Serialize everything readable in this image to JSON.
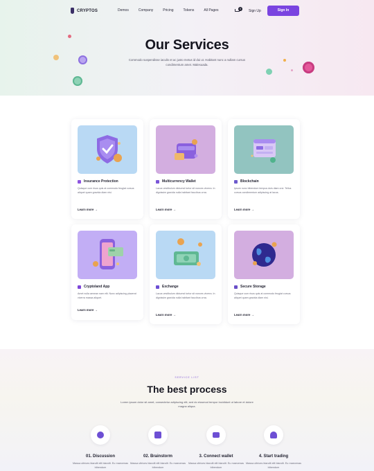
{
  "nav": {
    "logo": "CRYPTOS",
    "links": [
      "Demos",
      "Company",
      "Pricing",
      "Tokens",
      "All Pages"
    ],
    "cart_count": "0",
    "signup": "Sign Up",
    "signin": "Sign In"
  },
  "hero": {
    "title": "Our Services",
    "description": "Commodo suspendisse iaculis et ac justo metus id dui ut. Habitant nunc a nullam cursus condimentum amet. Malesuada."
  },
  "services": [
    {
      "title": "Insurance Protection",
      "text": "Quisque cum risus quis at commodo feugiat cursus aliquet quam gravida diam nisi.",
      "link": "Learn more",
      "icon": "chat-icon",
      "accent": "#8e55e0"
    },
    {
      "title": "Multicurrency Wallet",
      "text": "Lacus vestibulum dictumst tortor sit nonces viverra. In dignissim gravida nulla habitant faucibus urna.",
      "link": "Learn more",
      "icon": "wallet-icon",
      "accent": "#7a56d8"
    },
    {
      "title": "Blockchain",
      "text": "Ipsum nunc bibendum tempus duis diam orci. Tellus cursus condimentum adipiscing at lacus.",
      "link": "Learn more",
      "icon": "blocks-icon",
      "accent": "#6d5acd"
    },
    {
      "title": "Cryptoland App",
      "text": "Amet nulla aenean nam elit. Nunc adipiscing placerat viverra massa aliquet.",
      "link": "Learn more",
      "icon": "rocket-icon",
      "accent": "#7e46d9"
    },
    {
      "title": "Exchange",
      "text": "Lacus vestibulum dictumst tortor sit nonces viverra. In dignissim gravida nulla habitant faucibus urna.",
      "link": "Learn more",
      "icon": "exchange-icon",
      "accent": "#6d4fd4"
    },
    {
      "title": "Secure Storage",
      "text": "Quisque cum risus quis at commodo feugiat cursus aliquet quam gravida diam nisi.",
      "link": "Learn more",
      "icon": "shield-icon",
      "accent": "#6a4fc8"
    }
  ],
  "process": {
    "eyebrow": "SERVICE LIST",
    "title": "The best process",
    "description": "Lorem ipsum dolor sit amet, consectetur adipiscing elit, sed do eiusmod tempor incididunt ut labore et dolore magna aliqua.",
    "steps": [
      {
        "title": "01. Discussion",
        "text": "Massa ultrices blandit elit blandit. Eu maecenas bibendum",
        "icon": "chat-icon"
      },
      {
        "title": "02. Brainstorm",
        "text": "Massa ultrices blandit elit blandit. Eu maecenas bibendum",
        "icon": "wallet-icon"
      },
      {
        "title": "3. Connect wallet",
        "text": "Massa ultrices blandit elit blandit. Eu maecenas bibendum",
        "icon": "card-icon"
      },
      {
        "title": "4. Start trading",
        "text": "Massa ultrices blandit elit blandit. Eu maecenas bibendum",
        "icon": "user-icon"
      }
    ]
  }
}
